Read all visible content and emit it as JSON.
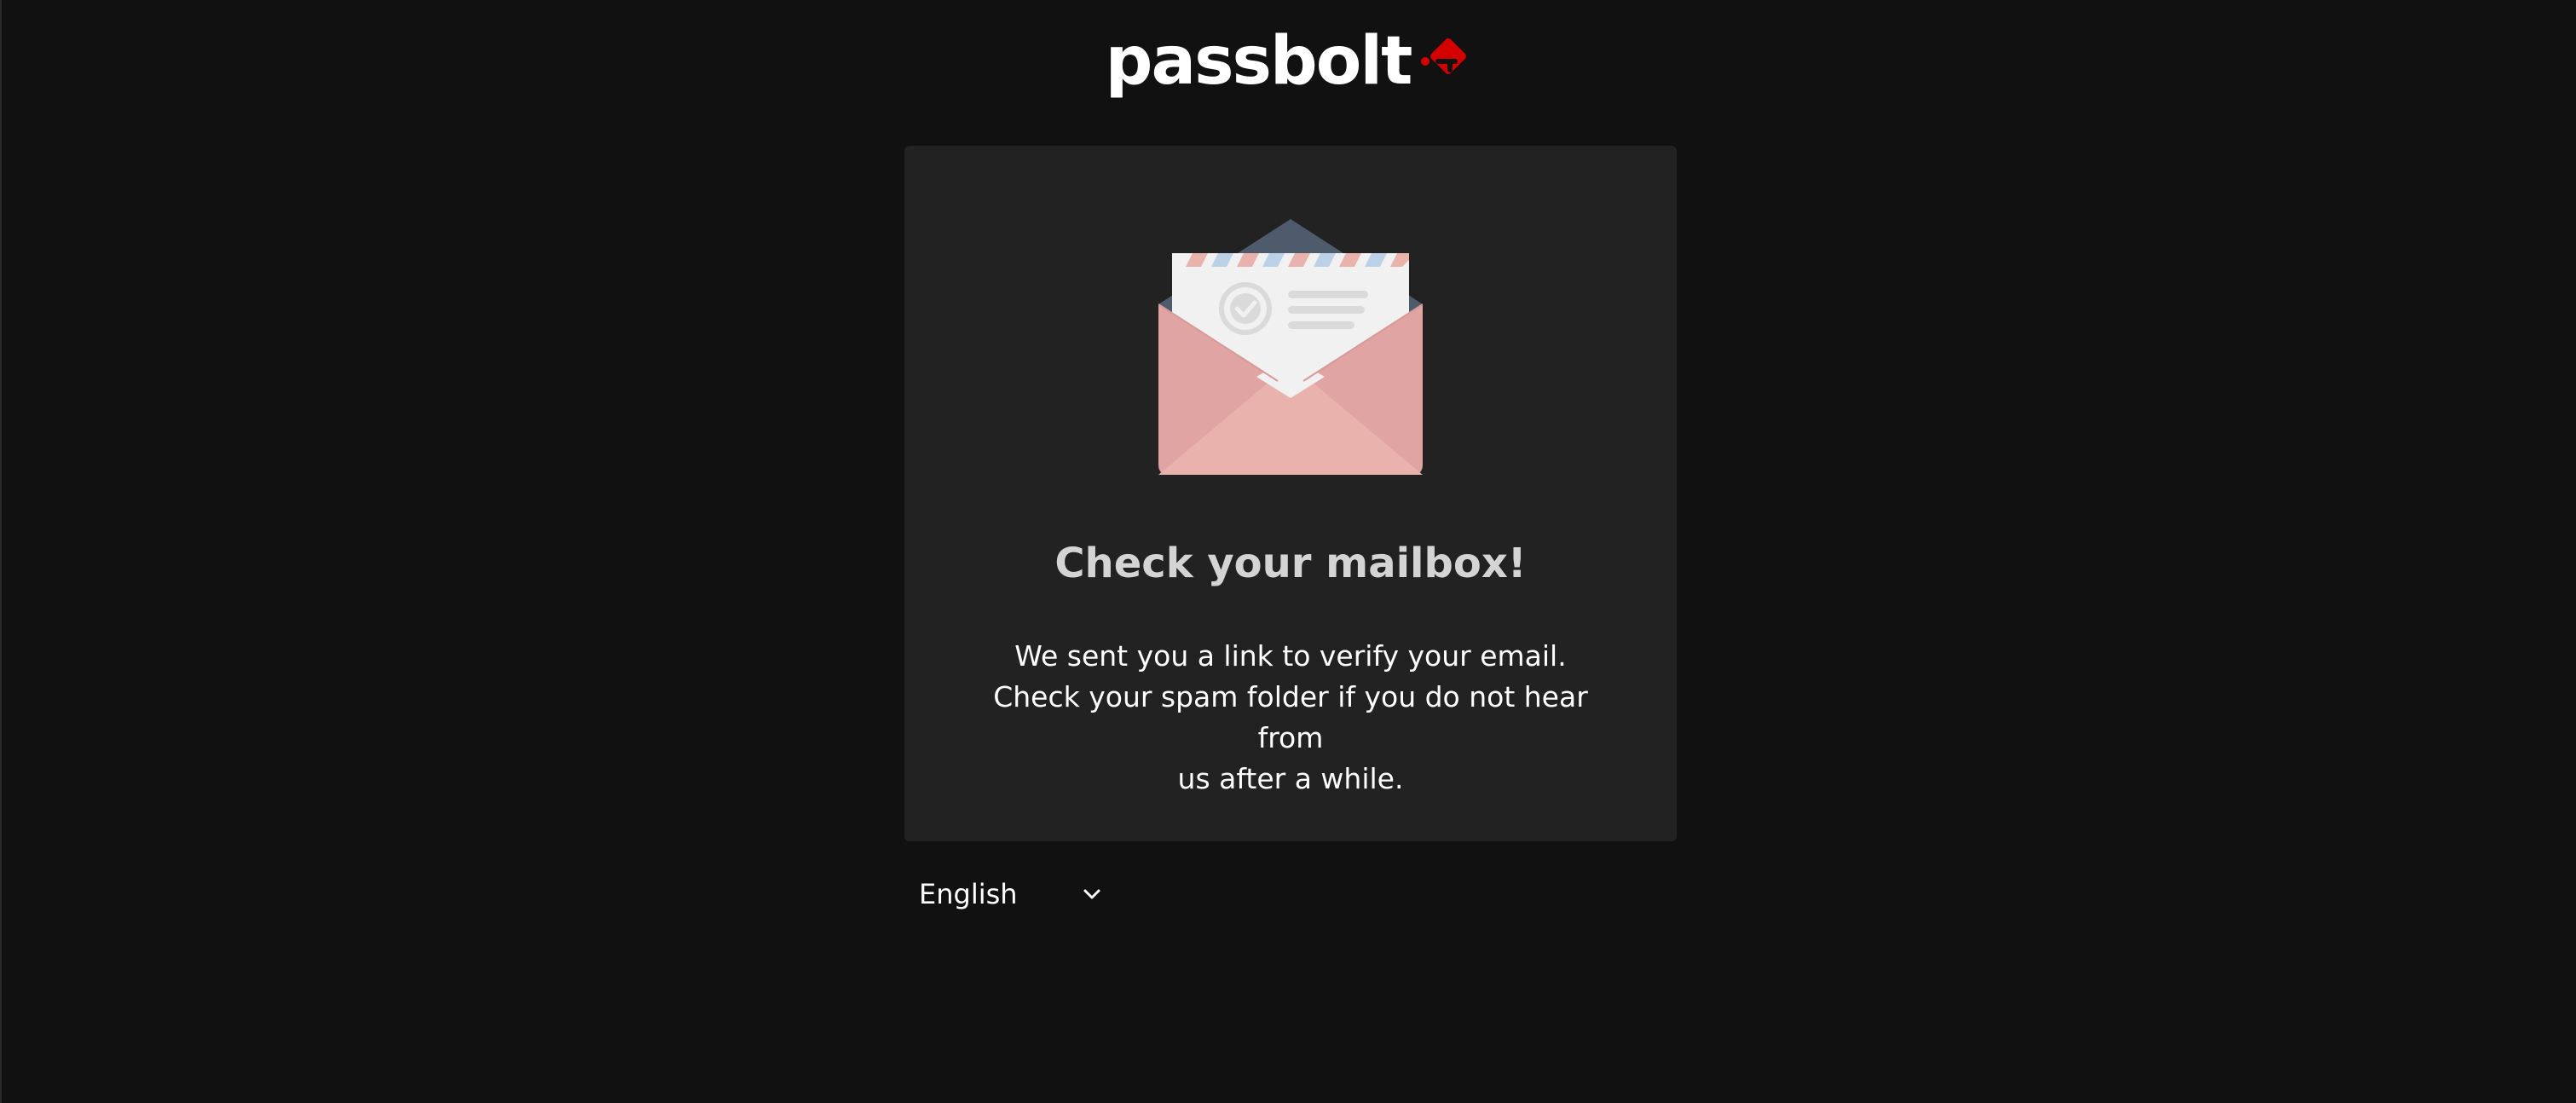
{
  "brand": {
    "name": "passbolt",
    "accent": "#d40101"
  },
  "card": {
    "title": "Check your mailbox!",
    "message_lines": [
      "We sent you a link to verify your email.",
      "Check your spam folder if you do not hear from",
      "us after a while."
    ],
    "illustration": "open-envelope-with-letter"
  },
  "language": {
    "selected": "English",
    "icon": "chevron-down-icon"
  },
  "colors": {
    "background": "#111111",
    "card_background": "#222222",
    "title_text": "#d4d4d4",
    "body_text": "#ffffff"
  }
}
